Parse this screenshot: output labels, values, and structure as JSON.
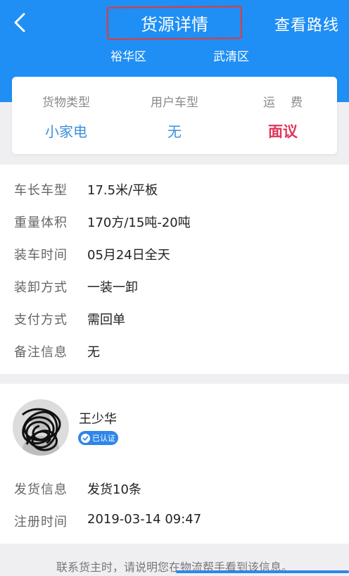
{
  "header": {
    "title": "货源详情",
    "route_label": "查看路线",
    "origin": "裕华区",
    "destination": "武清区"
  },
  "summary": {
    "cargo_type_label": "货物类型",
    "cargo_type_value": "小家电",
    "vehicle_type_label": "用户车型",
    "vehicle_type_value": "无",
    "freight_label": "运费",
    "freight_value": "面议"
  },
  "details": [
    {
      "label": "车长车型",
      "value": "17.5米/平板"
    },
    {
      "label": "重量体积",
      "value": "170方/15吨-20吨"
    },
    {
      "label": "装车时间",
      "value": "05月24日全天"
    },
    {
      "label": "装卸方式",
      "value": "一装一卸"
    },
    {
      "label": "支付方式",
      "value": "需回单"
    },
    {
      "label": "备注信息",
      "value": "无"
    }
  ],
  "shipper": {
    "name": "王少华",
    "badge": "已认证",
    "info_label": "发货信息",
    "info_value": "发货10条",
    "register_label": "注册时间",
    "register_value": "2019-03-14 09:47"
  },
  "footer_text": "联系货主时，请说明您在物流帮手看到该信息。",
  "colors": {
    "header_bg": "#1f8ef5",
    "accent": "#3d8fdc",
    "price": "#e2345a"
  }
}
